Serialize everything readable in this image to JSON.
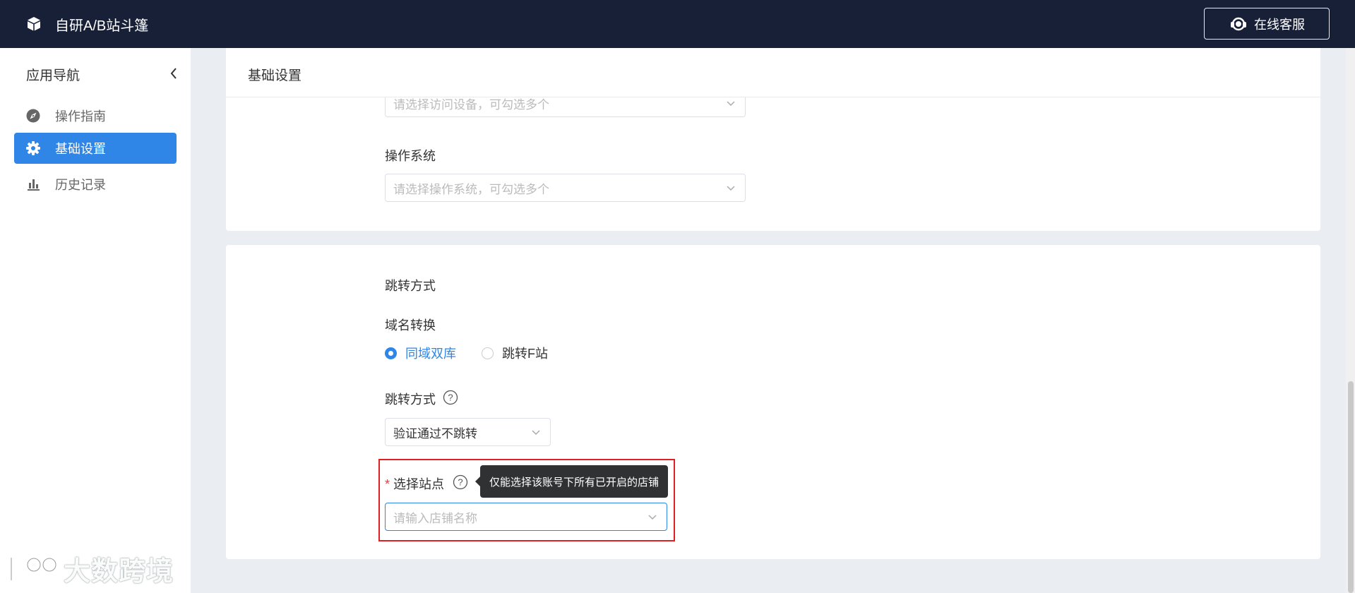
{
  "header": {
    "app_title": "自研A/B站斗篷",
    "service_label": "在线客服"
  },
  "sidebar": {
    "title": "应用导航",
    "items": [
      {
        "label": "操作指南",
        "icon": "compass-icon"
      },
      {
        "label": "基础设置",
        "icon": "gear-icon",
        "active": true
      },
      {
        "label": "历史记录",
        "icon": "bar-chart-icon"
      }
    ]
  },
  "watermark": "大数跨境",
  "card1": {
    "title": "基础设置",
    "device_select_placeholder": "请选择访问设备，可勾选多个",
    "os_label": "操作系统",
    "os_select_placeholder": "请选择操作系统，可勾选多个"
  },
  "card2": {
    "section_title": "跳转方式",
    "domain_label": "域名转换",
    "radio_options": [
      {
        "label": "同域双库",
        "checked": true
      },
      {
        "label": "跳转F站",
        "checked": false
      }
    ],
    "redirect_label": "跳转方式",
    "redirect_value": "验证通过不跳转",
    "site_required_mark": "*",
    "site_label": "选择站点",
    "site_placeholder": "请输入店铺名称",
    "tooltip": "仅能选择该账号下所有已开启的店铺"
  },
  "colors": {
    "topbar": "#182038",
    "accent": "#2f86e6",
    "highlight": "#e02020"
  }
}
